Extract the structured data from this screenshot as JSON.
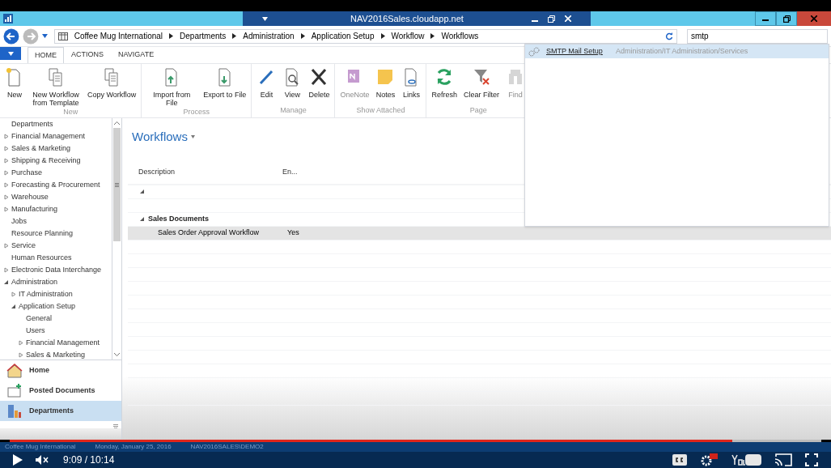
{
  "window": {
    "title": "NAV2016Sales.cloudapp.net"
  },
  "address_bar": {
    "breadcrumbs": [
      "Coffee Mug International",
      "Departments",
      "Administration",
      "Application Setup",
      "Workflow",
      "Workflows"
    ]
  },
  "search": {
    "value": "smtp"
  },
  "search_results": [
    {
      "name": "SMTP Mail Setup",
      "path": "Administration/IT Administration/Services",
      "selected": true
    }
  ],
  "ribbon_tabs": [
    {
      "label": "HOME",
      "selected": true
    },
    {
      "label": "ACTIONS",
      "selected": false
    },
    {
      "label": "NAVIGATE",
      "selected": false
    }
  ],
  "ribbon_groups": [
    {
      "label": "New",
      "buttons": [
        {
          "label": "New",
          "disabled": false
        },
        {
          "label": "New Workflow from Template",
          "disabled": false
        },
        {
          "label": "Copy Workflow",
          "disabled": false
        }
      ]
    },
    {
      "label": "Process",
      "buttons": [
        {
          "label": "Import from File",
          "disabled": false
        },
        {
          "label": "Export to File",
          "disabled": false
        }
      ]
    },
    {
      "label": "Manage",
      "buttons": [
        {
          "label": "Edit",
          "disabled": false
        },
        {
          "label": "View",
          "disabled": false
        },
        {
          "label": "Delete",
          "disabled": false
        }
      ]
    },
    {
      "label": "Show Attached",
      "buttons": [
        {
          "label": "OneNote",
          "disabled": true
        },
        {
          "label": "Notes",
          "disabled": false
        },
        {
          "label": "Links",
          "disabled": false
        }
      ]
    },
    {
      "label": "Page",
      "buttons": [
        {
          "label": "Refresh",
          "disabled": false
        },
        {
          "label": "Clear Filter",
          "disabled": false
        },
        {
          "label": "Find",
          "disabled": true
        }
      ]
    }
  ],
  "navigation_tree": [
    {
      "label": "Departments"
    },
    {
      "label": "Financial Management",
      "expanded": false
    },
    {
      "label": "Sales & Marketing",
      "expanded": false
    },
    {
      "label": "Shipping & Receiving",
      "expanded": false
    },
    {
      "label": "Purchase",
      "expanded": false
    },
    {
      "label": "Forecasting & Procurement",
      "expanded": false
    },
    {
      "label": "Warehouse",
      "expanded": false
    },
    {
      "label": "Manufacturing",
      "expanded": false
    },
    {
      "label": "Jobs"
    },
    {
      "label": "Resource Planning"
    },
    {
      "label": "Service",
      "expanded": false
    },
    {
      "label": "Human Resources"
    },
    {
      "label": "Electronic Data Interchange",
      "expanded": false
    },
    {
      "label": "Administration",
      "expanded": true,
      "children": [
        {
          "label": "IT Administration",
          "expanded": false
        },
        {
          "label": "Application Setup",
          "expanded": true,
          "children": [
            {
              "label": "General"
            },
            {
              "label": "Users"
            },
            {
              "label": "Financial Management",
              "expanded": false
            },
            {
              "label": "Sales & Marketing",
              "expanded": false
            }
          ]
        }
      ]
    }
  ],
  "navigation_pane": [
    {
      "label": "Home",
      "selected": false
    },
    {
      "label": "Posted Documents",
      "selected": false
    },
    {
      "label": "Departments",
      "selected": true
    }
  ],
  "page": {
    "title": "Workflows",
    "columns": [
      "Description",
      "En..."
    ],
    "groups": [
      {
        "expanded": true
      },
      {
        "label": "Sales Documents",
        "expanded": true,
        "rows": [
          {
            "description": "Sales Order Approval Workflow",
            "enabled": "Yes",
            "selected": true
          }
        ]
      }
    ]
  },
  "status_bar": [
    "Coffee Mug International",
    "Monday, January 25, 2016",
    "NAV2016SALES\\DEMO2"
  ],
  "video_player": {
    "time": "9:09 / 10:14",
    "level": 0.89
  }
}
